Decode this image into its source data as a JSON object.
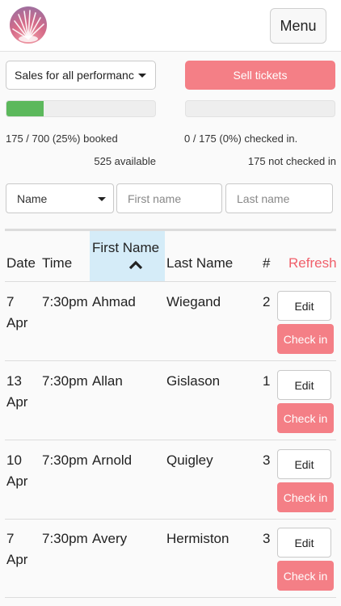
{
  "header": {
    "menu_label": "Menu"
  },
  "controls": {
    "performance_select": "Sales for all performanc",
    "sell_label": "Sell tickets"
  },
  "stats": {
    "booked_fraction": 0.25,
    "checked_in_fraction": 0.0,
    "booked_text": "175 / 700 (25%) booked",
    "available_text": "525 available",
    "checked_in_text": "0 / 175 (0%) checked in.",
    "not_checked_text": "175 not checked in"
  },
  "search": {
    "field_select": "Name",
    "first_placeholder": "First name",
    "last_placeholder": "Last name"
  },
  "table": {
    "headers": {
      "date": "Date",
      "time": "Time",
      "first": "First Name",
      "last": "Last Name",
      "count": "#",
      "refresh": "Refresh"
    },
    "edit_label": "Edit",
    "checkin_label": "Check in",
    "rows": [
      {
        "day": "7",
        "month": "Apr",
        "time": "7:30pm",
        "first": "Ahmad",
        "last": "Wiegand",
        "count": "2"
      },
      {
        "day": "13",
        "month": "Apr",
        "time": "7:30pm",
        "first": "Allan",
        "last": "Gislason",
        "count": "1"
      },
      {
        "day": "10",
        "month": "Apr",
        "time": "7:30pm",
        "first": "Arnold",
        "last": "Quigley",
        "count": "3"
      },
      {
        "day": "7",
        "month": "Apr",
        "time": "7:30pm",
        "first": "Avery",
        "last": "Hermiston",
        "count": "3"
      }
    ]
  },
  "colors": {
    "accent": "#f47f86",
    "progress": "#5cb85c",
    "sort_highlight": "#d5ecf8"
  }
}
